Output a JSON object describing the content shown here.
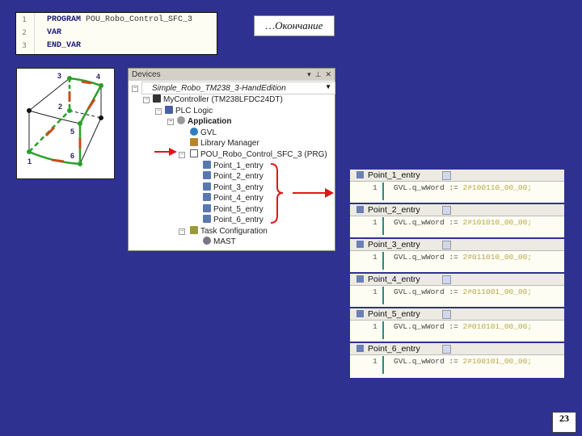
{
  "header_code": {
    "lines": [
      {
        "num": "1",
        "keyword": "PROGRAM",
        "name": "POU_Robo_Control_SFC_3"
      },
      {
        "num": "2",
        "keyword": "VAR",
        "name": ""
      },
      {
        "num": "3",
        "keyword": "END_VAR",
        "name": ""
      }
    ]
  },
  "title": "…Окончание",
  "diagram": {
    "points": [
      "1",
      "2",
      "3",
      "4",
      "5",
      "6"
    ],
    "edge_color": "#2aa02a",
    "arrow_color": "#c84b1e"
  },
  "devices": {
    "title": "Devices",
    "items": [
      {
        "label": "Simple_Robo_TM238_3-HandEdition",
        "icon": "project-icon"
      },
      {
        "label": "MyController (TM238LFDC24DT)",
        "icon": "controller-icon"
      },
      {
        "label": "PLC Logic",
        "icon": "plc-logic-icon"
      },
      {
        "label": "Application",
        "icon": "gear-icon"
      },
      {
        "label": "GVL",
        "icon": "globe-icon"
      },
      {
        "label": "Library Manager",
        "icon": "library-icon"
      },
      {
        "label": "POU_Robo_Control_SFC_3 (PRG)",
        "icon": "pou-icon"
      },
      {
        "label": "Point_1_entry",
        "icon": "action-icon"
      },
      {
        "label": "Point_2_entry",
        "icon": "action-icon"
      },
      {
        "label": "Point_3_entry",
        "icon": "action-icon"
      },
      {
        "label": "Point_4_entry",
        "icon": "action-icon"
      },
      {
        "label": "Point_5_entry",
        "icon": "action-icon"
      },
      {
        "label": "Point_6_entry",
        "icon": "action-icon"
      },
      {
        "label": "Task Configuration",
        "icon": "task-config-icon"
      },
      {
        "label": "MAST",
        "icon": "task-icon"
      }
    ]
  },
  "entries": [
    {
      "tab": "Point_1_entry",
      "num": "1",
      "code": "GVL.q_wWord := ",
      "value": "2#100110_00_00;"
    },
    {
      "tab": "Point_2_entry",
      "num": "1",
      "code": "GVL.q_wWord := ",
      "value": "2#101010_00_00;"
    },
    {
      "tab": "Point_3_entry",
      "num": "1",
      "code": "GVL.q_wWord := ",
      "value": "2#011010_00_00;"
    },
    {
      "tab": "Point_4_entry",
      "num": "1",
      "code": "GVL.q_wWord := ",
      "value": "2#011001_00_00;"
    },
    {
      "tab": "Point_5_entry",
      "num": "1",
      "code": "GVL.q_wWord := ",
      "value": "2#010101_00_00;"
    },
    {
      "tab": "Point_6_entry",
      "num": "1",
      "code": "GVL.q_wWord := ",
      "value": "2#100101_00_00;"
    }
  ],
  "slide_number": "23",
  "colors": {
    "background": "#2f3191",
    "annotation_red": "#e0161b"
  }
}
